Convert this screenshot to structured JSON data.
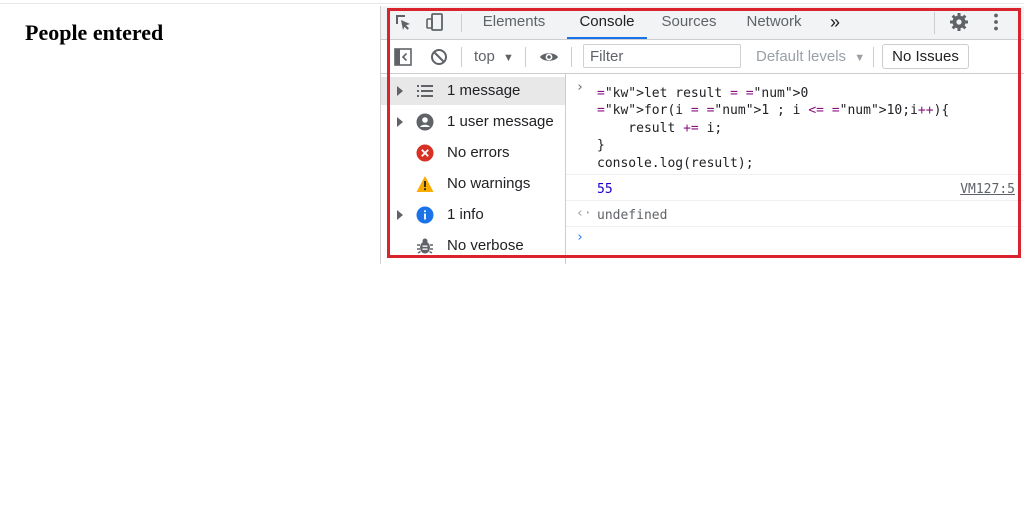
{
  "page": {
    "heading": "People entered"
  },
  "tabs": [
    {
      "label": "Elements"
    },
    {
      "label": "Console"
    },
    {
      "label": "Sources"
    },
    {
      "label": "Network"
    }
  ],
  "tab_overflow": "»",
  "toolbar": {
    "context": "top",
    "filter_placeholder": "Filter",
    "levels": "Default levels",
    "issues": "No Issues"
  },
  "sidebar": {
    "items": [
      {
        "label": "1 message",
        "icon": "list-icon"
      },
      {
        "label": "1 user message",
        "icon": "user-icon"
      },
      {
        "label": "No errors",
        "icon": "error-icon"
      },
      {
        "label": "No warnings",
        "icon": "warning-icon"
      },
      {
        "label": "1 info",
        "icon": "info-icon"
      },
      {
        "label": "No verbose",
        "icon": "bug-icon"
      }
    ]
  },
  "console": {
    "input_lines": [
      "let result = 0",
      "for(i = 1 ; i <= 10;i++){",
      "    result += i;",
      "}",
      "console.log(result);"
    ],
    "output_value": "55",
    "output_source": "VM127:5",
    "return_value": "undefined"
  },
  "colors": {
    "accent": "#1a73e8",
    "highlight": "#d9232d",
    "error": "#d93025",
    "warning": "#f9ab00",
    "info": "#1a73e8"
  }
}
